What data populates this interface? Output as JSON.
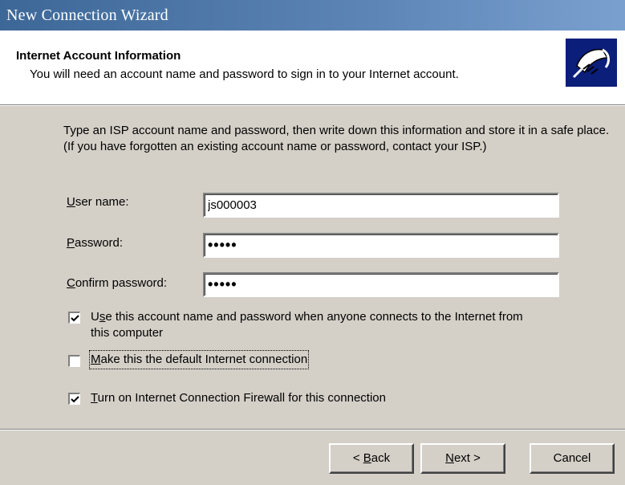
{
  "window": {
    "title": "New Connection Wizard"
  },
  "header": {
    "title": "Internet Account Information",
    "subtitle": "You will need an account name and password to sign in to your Internet account."
  },
  "intro_text": "Type an ISP account name and password, then write down this information and store it in a safe place. (If you have forgotten an existing account name or password, contact your ISP.)",
  "form": {
    "username_label_key": "U",
    "username_label_rest": "ser name:",
    "username_value": "js000003",
    "password_label_key": "P",
    "password_label_rest": "assword:",
    "password_value": "•••••",
    "confirm_label_key": "C",
    "confirm_label_rest": "onfirm password:",
    "confirm_value": "•••••"
  },
  "options": {
    "use_account": {
      "checked": true,
      "key": "s",
      "prefix": "U",
      "rest": "e this account  name and password when anyone connects to the Internet from",
      "line2": "this computer"
    },
    "default_connection": {
      "checked": false,
      "key": "M",
      "rest": "ake this the default Internet connection"
    },
    "firewall": {
      "checked": true,
      "key": "T",
      "rest": "urn on Internet Connection Firewall for this connection"
    }
  },
  "buttons": {
    "back_prefix": "< ",
    "back_key": "B",
    "back_rest": "ack",
    "next_key": "N",
    "next_rest": "ext >",
    "cancel": "Cancel"
  },
  "colors": {
    "titlebar": "#3d6797",
    "face": "#d4d0c8",
    "icon_bg": "#0a1e7a"
  },
  "icons": {
    "header_icon": "phone-plug-icon"
  }
}
